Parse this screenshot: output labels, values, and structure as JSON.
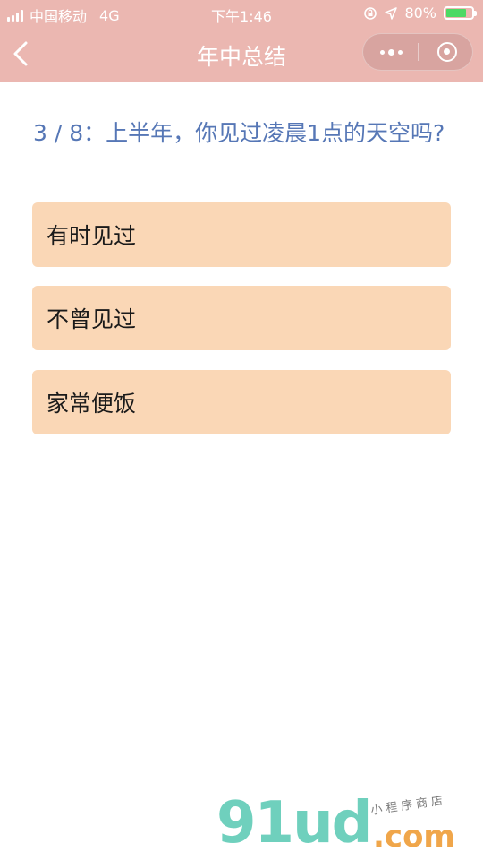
{
  "status_bar": {
    "carrier": "中国移动",
    "network": "4G",
    "time": "下午1:46",
    "battery_percent": "80%",
    "battery_level": 0.8,
    "battery_color": "#4cd964"
  },
  "nav_bar": {
    "title": "年中总结",
    "back_icon": "chevron-left-icon",
    "more_icon": "more-dots-icon",
    "close_icon": "target-circle-icon",
    "background_color": "#ebb7b1"
  },
  "question": {
    "text": "3 / 8：上半年，你见过凌晨1点的天空吗?",
    "color": "#5677b6"
  },
  "options": [
    {
      "label": "有时见过"
    },
    {
      "label": "不曾见过"
    },
    {
      "label": "家常便饭"
    }
  ],
  "option_color": "#fad7b6",
  "watermark": {
    "logo": "91ud",
    "domain": ".com",
    "subtitle": "小程序商店"
  }
}
